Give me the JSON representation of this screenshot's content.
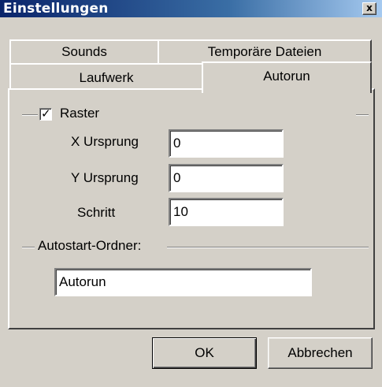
{
  "window": {
    "title": "Einstellungen",
    "close_label": "x"
  },
  "tabs": {
    "row_back": [
      "Sounds",
      "Temporäre Dateien"
    ],
    "row_front": [
      "Laufwerk",
      "Autorun"
    ],
    "selected": "Autorun"
  },
  "raster": {
    "label": "Raster",
    "checked": true,
    "check_glyph": "✓",
    "x_label": "X Ursprung",
    "x_value": "0",
    "y_label": "Y Ursprung",
    "y_value": "0",
    "step_label": "Schritt",
    "step_value": "10"
  },
  "autostart": {
    "label": "Autostart-Ordner:",
    "value": "Autorun"
  },
  "buttons": {
    "ok": "OK",
    "cancel": "Abbrechen"
  }
}
